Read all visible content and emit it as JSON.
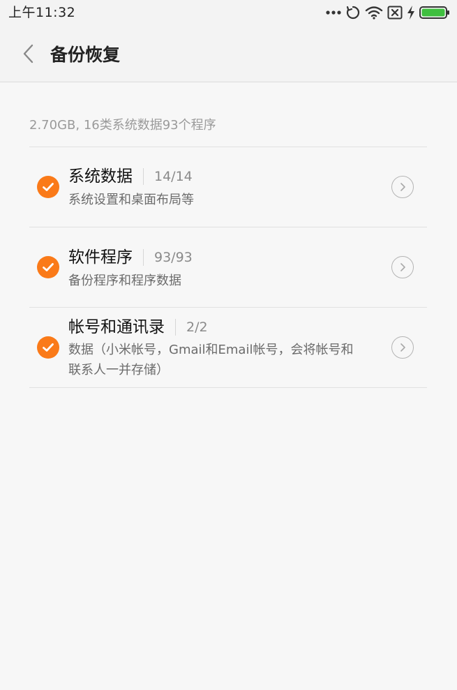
{
  "status_bar": {
    "time": "上午11:32",
    "icons": [
      "more-dots-icon",
      "sync-icon",
      "wifi-icon",
      "no-sim-icon",
      "charging-icon",
      "battery-icon"
    ],
    "battery_color": "#3fbf3f"
  },
  "header": {
    "back_icon": "chevron-left-icon",
    "title": "备份恢复"
  },
  "summary": {
    "text": "2.70GB, 16类系统数据93个程序"
  },
  "items": [
    {
      "title": "系统数据",
      "count": "14/14",
      "description": "系统设置和桌面布局等",
      "checked": true
    },
    {
      "title": "软件程序",
      "count": "93/93",
      "description": "备份程序和程序数据",
      "checked": true
    },
    {
      "title": "帐号和通讯录",
      "count": "2/2",
      "description": "数据（小米帐号，Gmail和Email帐号，会将帐号和联系人一并存储）",
      "checked": true
    }
  ],
  "colors": {
    "accent": "#fa7a19",
    "background": "#f7f7f7",
    "header_background": "#f3f3f3"
  }
}
